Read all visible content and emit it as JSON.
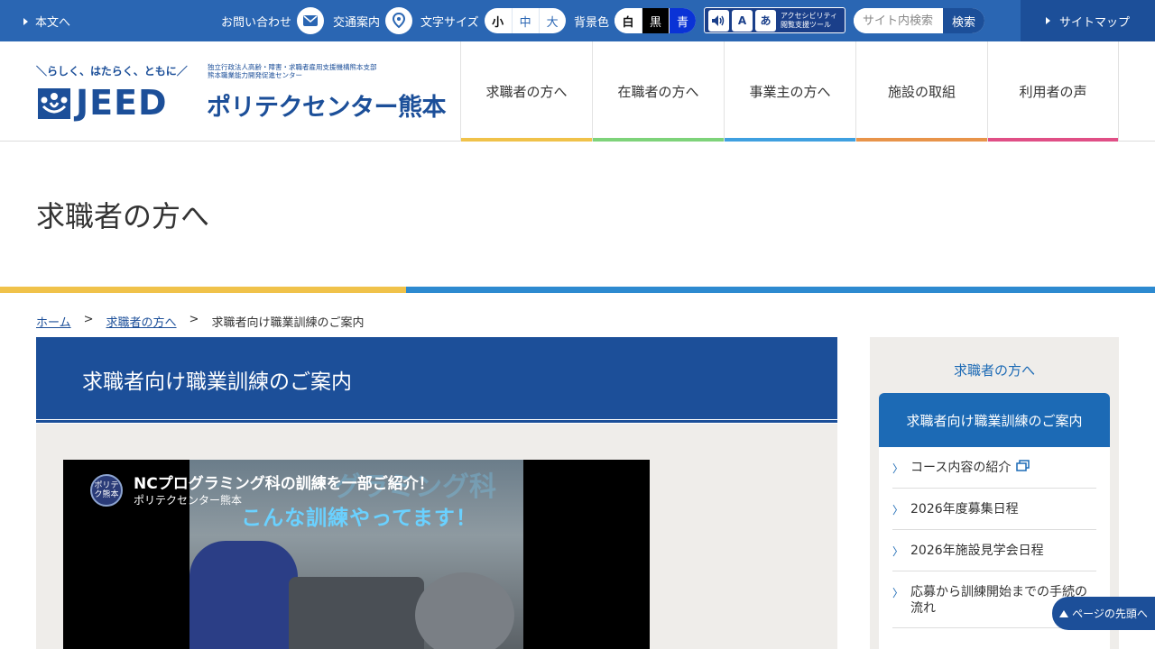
{
  "topbar": {
    "skip_link": "本文へ",
    "contact": "お問い合わせ",
    "access": "交通案内",
    "font_size_label": "文字サイズ",
    "font_sizes": [
      "小",
      "中",
      "大"
    ],
    "bg_label": "背景色",
    "bg_colors": [
      "白",
      "黒",
      "青"
    ],
    "accessibility_tool": "アクセシビリティ閲覧支援ツール",
    "search_placeholder": "サイト内検索",
    "search_button": "検索",
    "sitemap": "サイトマップ"
  },
  "header": {
    "slogan": "らしく、はたらく、ともに",
    "org_line1": "独立行政法人高齢・障害・求職者雇用支援機構熊本支部",
    "org_line2": "熊本職業能力開発促進センター",
    "logo_text": "JEED",
    "center_name": "ポリテクセンター熊本",
    "nav": [
      {
        "label": "求職者の方へ",
        "color": "#f0c24a"
      },
      {
        "label": "在職者の方へ",
        "color": "#7ed37a"
      },
      {
        "label": "事業主の方へ",
        "color": "#3fa0e0"
      },
      {
        "label": "施設の取組",
        "color": "#e8944a"
      },
      {
        "label": "利用者の声",
        "color": "#e04f86"
      }
    ]
  },
  "page_title": "求職者の方へ",
  "breadcrumb": {
    "home": "ホーム",
    "parent": "求職者の方へ",
    "sep": ">",
    "current": "求職者向け職業訓練のご案内"
  },
  "main": {
    "heading": "求職者向け職業訓練のご案内",
    "video": {
      "title": "NCプログラミング科の訓練を一部ご紹介！",
      "channel": "ポリテクセンター熊本",
      "subtitle": "こんな訓練やってます！",
      "overlay_text": "グラミング科",
      "avatar_text": "ポリテク熊本"
    }
  },
  "sidebar": {
    "title": "求職者の方へ",
    "current": "求職者向け職業訓練のご案内",
    "items": [
      "コース内容の紹介",
      "2026年度募集日程",
      "2026年施設見学会日程",
      "応募から訓練開始までの手続の流れ"
    ]
  },
  "pagetop": "ページの先頭へ"
}
